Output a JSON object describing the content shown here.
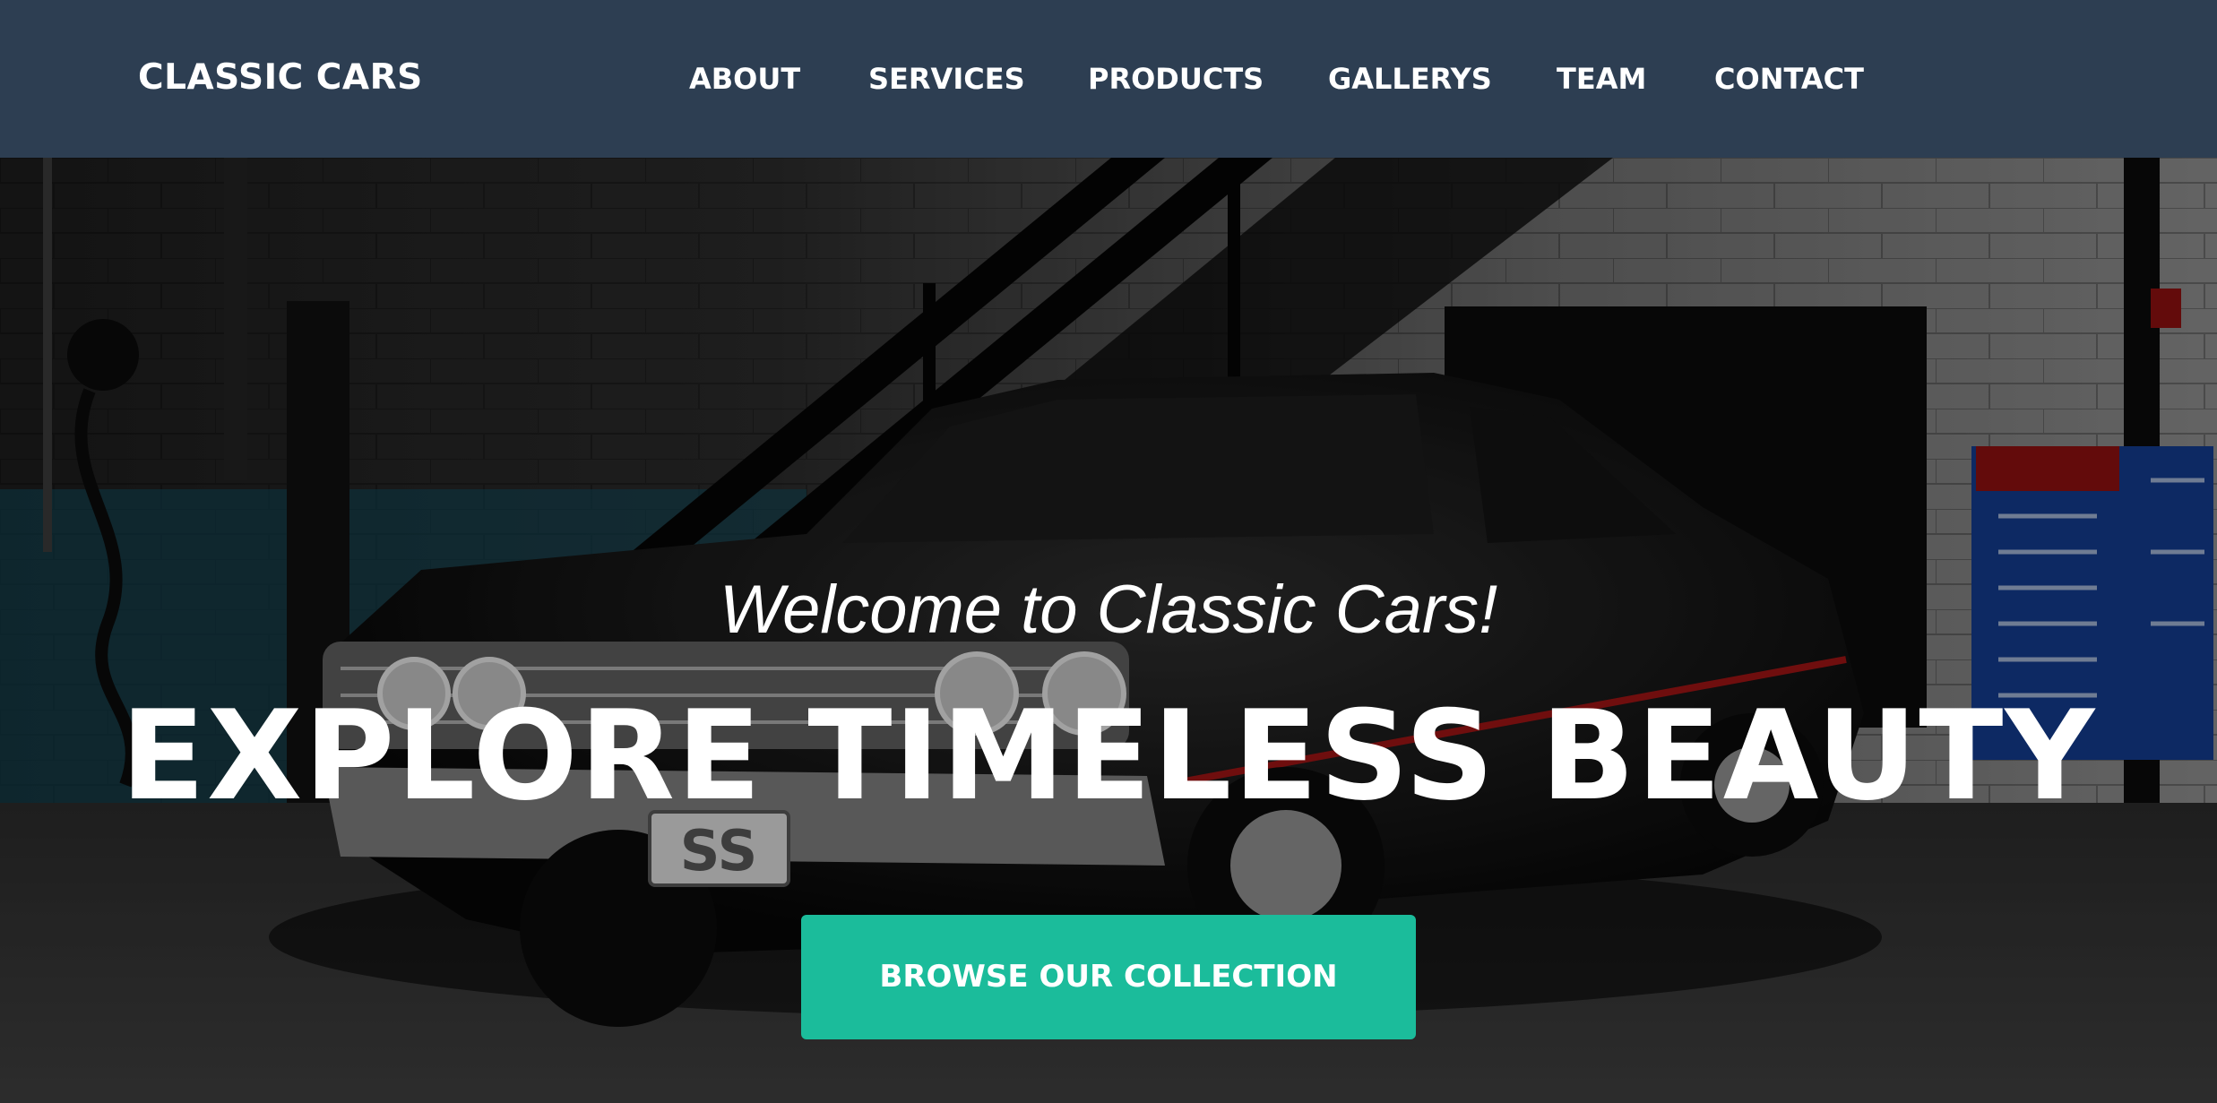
{
  "header": {
    "brand": "CLASSIC CARS",
    "nav": [
      {
        "label": "ABOUT"
      },
      {
        "label": "SERVICES"
      },
      {
        "label": "PRODUCTS"
      },
      {
        "label": "GALLERYS"
      },
      {
        "label": "TEAM"
      },
      {
        "label": "CONTACT"
      }
    ]
  },
  "hero": {
    "welcome": "Welcome to Classic Cars!",
    "headline": "EXPLORE TIMELESS BEAUTY",
    "cta_label": "BROWSE OUR COLLECTION",
    "plate_text": "SS"
  },
  "colors": {
    "navbar_bg": "#2d3e52",
    "cta_bg": "#1bbc9b",
    "text": "#ffffff"
  }
}
